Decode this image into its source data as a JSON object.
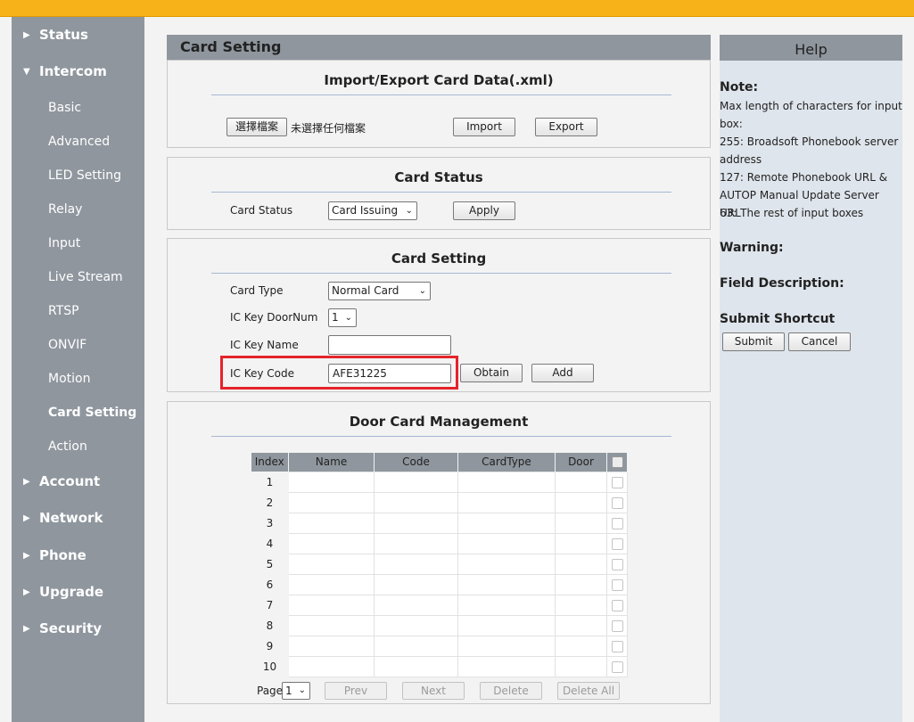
{
  "sidebar": {
    "status": "Status",
    "intercom": "Intercom",
    "intercom_items": [
      "Basic",
      "Advanced",
      "LED Setting",
      "Relay",
      "Input",
      "Live Stream",
      "RTSP",
      "ONVIF",
      "Motion",
      "Card Setting",
      "Action"
    ],
    "account": "Account",
    "network": "Network",
    "phone": "Phone",
    "upgrade": "Upgrade",
    "security": "Security",
    "active_item": "Card Setting"
  },
  "page_title": "Card Setting",
  "import_export": {
    "title": "Import/Export Card Data(.xml)",
    "choose_file_label": "選擇檔案",
    "no_file_text": "未選擇任何檔案",
    "import_label": "Import",
    "export_label": "Export"
  },
  "card_status": {
    "title": "Card Status",
    "label": "Card Status",
    "selected": "Card Issuing",
    "apply_label": "Apply"
  },
  "card_setting": {
    "title": "Card Setting",
    "card_type_label": "Card Type",
    "card_type_value": "Normal Card",
    "door_num_label": "IC Key DoorNum",
    "door_num_value": "1",
    "key_name_label": "IC Key Name",
    "key_name_value": "",
    "key_code_label": "IC Key Code",
    "key_code_value": "AFE31225",
    "obtain_label": "Obtain",
    "add_label": "Add"
  },
  "door_card": {
    "title": "Door Card Management",
    "columns": [
      "Index",
      "Name",
      "Code",
      "CardType",
      "Door"
    ],
    "rows": [
      "1",
      "2",
      "3",
      "4",
      "5",
      "6",
      "7",
      "8",
      "9",
      "10"
    ],
    "page_label": "Page",
    "page_value": "1",
    "prev_label": "Prev",
    "next_label": "Next",
    "delete_label": "Delete",
    "delete_all_label": "Delete All"
  },
  "help": {
    "title": "Help",
    "note_heading": "Note:",
    "note_lines": [
      "Max length of characters for input",
      "box:",
      "255: Broadsoft Phonebook server",
      "address",
      "127: Remote Phonebook URL &",
      "AUTOP Manual Update Server URL",
      "63: The rest of input boxes"
    ],
    "warning_heading": "Warning:",
    "field_heading": "Field Description:",
    "shortcut_heading": "Submit Shortcut",
    "submit_label": "Submit",
    "cancel_label": "Cancel"
  },
  "colors": {
    "top_bar": "#f7b119",
    "sidebar": "#8f969e",
    "help_bg": "#dfe5ec",
    "highlight": "#e4242a"
  }
}
